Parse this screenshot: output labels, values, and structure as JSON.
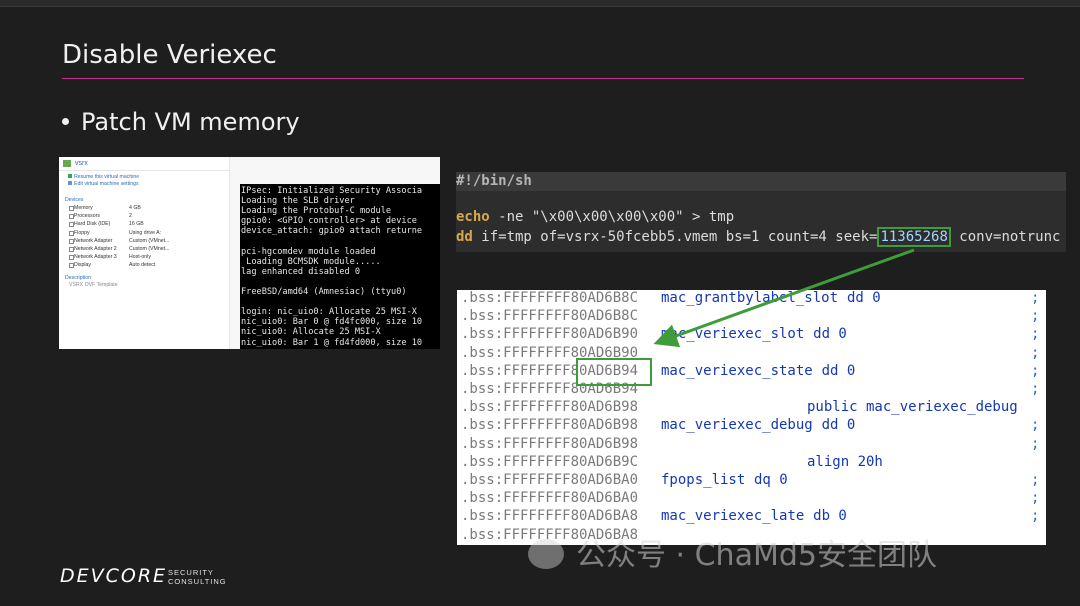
{
  "slide": {
    "title": "Disable Veriexec",
    "bullet": "Patch VM memory"
  },
  "vm": {
    "title": "vsrx",
    "actions": [
      "Resume this virtual machine",
      "Edit virtual machine settings"
    ],
    "devices_header": "Devices",
    "devices": [
      {
        "name": "Memory",
        "value": "4 GB"
      },
      {
        "name": "Processors",
        "value": "2"
      },
      {
        "name": "Hard Disk (IDE)",
        "value": "16 GB"
      },
      {
        "name": "Floppy",
        "value": "Using drive A:"
      },
      {
        "name": "Network Adapter",
        "value": "Custom (VMnet..."
      },
      {
        "name": "Network Adapter 2",
        "value": "Custom (VMnet..."
      },
      {
        "name": "Network Adapter 3",
        "value": "Host-only"
      },
      {
        "name": "Display",
        "value": "Auto detect"
      }
    ],
    "description_header": "Description",
    "description": "VSRX OVF Template",
    "console": [
      "IPsec: Initialized Security Associa",
      "Loading the SLB driver",
      "Loading the Protobuf-C module",
      "gpio0: <GPIO controller> at device",
      "device_attach: gpio0 attach returne",
      "",
      "pci-hgcomdev module loaded",
      " Loading BCMSDK module.....",
      "lag enhanced disabled 0",
      "",
      "FreeBSD/amd64 (Amnesiac) (ttyu0)",
      "",
      "login: nic_uio0: Allocate 25 MSI-X",
      "nic_uio0: Bar 0 @ fd4fc000, size 10",
      "nic_uio0: Allocate 25 MSI-X",
      "nic_uio0: Bar 1 @ fd4fd000, size 10"
    ]
  },
  "script": {
    "shebang": "#!/bin/sh",
    "line1": {
      "kw": "echo",
      "rest": " -ne \"\\x00\\x00\\x00\\x00\" > tmp"
    },
    "line2": {
      "kw": "dd",
      "before": " if=tmp of=vsrx-50fcebb5.vmem bs=1 count=4 seek=",
      "seek": "11365268",
      "after": " conv=notrunc"
    }
  },
  "disasm": [
    {
      "addr": ".bss:FFFFFFFF80AD6B8C",
      "sym": "mac_grantbylabel_slot",
      "ins": "dd 0",
      "semi": ";"
    },
    {
      "addr": ".bss:FFFFFFFF80AD6B8C",
      "sym": "",
      "ins": "",
      "semi": ";"
    },
    {
      "addr": ".bss:FFFFFFFF80AD6B90",
      "sym": "mac_veriexec_slot",
      "ins": "dd 0",
      "semi": ";"
    },
    {
      "addr": ".bss:FFFFFFFF80AD6B90",
      "sym": "",
      "ins": "",
      "semi": ";"
    },
    {
      "addr": ".bss:FFFFFFFF80AD6B94",
      "sym": "mac_veriexec_state",
      "ins": "dd 0",
      "semi": ";"
    },
    {
      "addr": ".bss:FFFFFFFF80AD6B94",
      "sym": "",
      "ins": "",
      "semi": ";"
    },
    {
      "addr": ".bss:FFFFFFFF80AD6B98",
      "sym": "",
      "ins": "public mac_veriexec_debug",
      "semi": ""
    },
    {
      "addr": ".bss:FFFFFFFF80AD6B98",
      "sym": "mac_veriexec_debug",
      "ins": "dd 0",
      "semi": ";"
    },
    {
      "addr": ".bss:FFFFFFFF80AD6B98",
      "sym": "",
      "ins": "",
      "semi": ";"
    },
    {
      "addr": ".bss:FFFFFFFF80AD6B9C",
      "sym": "",
      "ins": "align 20h",
      "semi": ""
    },
    {
      "addr": ".bss:FFFFFFFF80AD6BA0",
      "sym": "fpops_list",
      "ins": "dq 0",
      "semi": ";"
    },
    {
      "addr": ".bss:FFFFFFFF80AD6BA0",
      "sym": "",
      "ins": "",
      "semi": ";"
    },
    {
      "addr": ".bss:FFFFFFFF80AD6BA8",
      "sym": "mac_veriexec_late",
      "ins": "db 0",
      "semi": ";"
    },
    {
      "addr": ".bss:FFFFFFFF80AD6BA8",
      "sym": "",
      "ins": "",
      "semi": ""
    }
  ],
  "footer": {
    "logo": "DEVCORE",
    "logo_sub_1": "SECURITY",
    "logo_sub_2": "CONSULTING",
    "watermark": "公众号 · ChaMd5安全团队"
  },
  "colors": {
    "accent_rule": "#c0358f",
    "highlight_box": "#3f9c3a"
  }
}
